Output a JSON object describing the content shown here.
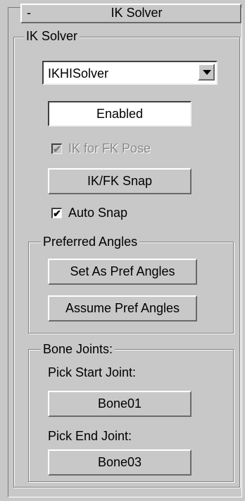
{
  "rollout": {
    "toggle": "-",
    "title": "IK Solver"
  },
  "ik_solver_group": {
    "label": "IK Solver",
    "solver_dropdown": {
      "selected": "IKHISolver"
    },
    "enabled_field": "Enabled",
    "ik_for_fk_pose": {
      "label": "IK for FK Pose",
      "checked": true,
      "enabled": false
    },
    "ik_fk_snap_button": "IK/FK Snap",
    "auto_snap": {
      "label": "Auto Snap",
      "checked": true
    }
  },
  "preferred_angles_group": {
    "label": "Preferred Angles",
    "set_button": "Set As Pref Angles",
    "assume_button": "Assume Pref Angles"
  },
  "bone_joints_group": {
    "label": "Bone Joints:",
    "start_label": "Pick Start Joint:",
    "start_button": "Bone01",
    "end_label": "Pick End Joint:",
    "end_button": "Bone03"
  },
  "glyphs": {
    "check": "✔"
  }
}
